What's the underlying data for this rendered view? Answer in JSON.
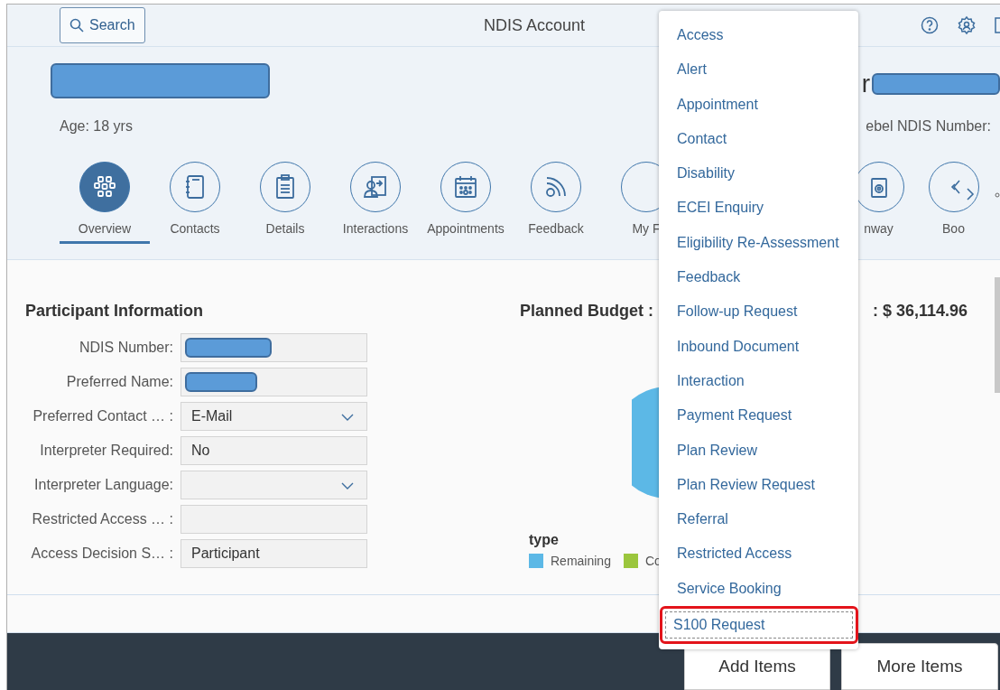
{
  "header": {
    "search_button": "Search",
    "title": "NDIS Account"
  },
  "profile": {
    "age": "Age: 18 yrs",
    "right_name_prefix": "r",
    "right_number_label": "ebel NDIS Number:"
  },
  "tabs": [
    {
      "label": "Overview",
      "selected": true
    },
    {
      "label": "Contacts",
      "selected": false
    },
    {
      "label": "Details",
      "selected": false
    },
    {
      "label": "Interactions",
      "selected": false
    },
    {
      "label": "Appointments",
      "selected": false
    },
    {
      "label": "Feedback",
      "selected": false
    },
    {
      "label": "My F",
      "selected": false
    },
    {
      "label": "nway",
      "selected": false
    },
    {
      "label": "Boo",
      "selected": false
    }
  ],
  "participant_information": {
    "title": "Participant Information",
    "fields": [
      {
        "label": "NDIS Number:",
        "kind": "redacted"
      },
      {
        "label": "Preferred Name:",
        "kind": "redacted"
      },
      {
        "label": "Preferred Contact … :",
        "kind": "select",
        "value": "E-Mail"
      },
      {
        "label": "Interpreter Required:",
        "kind": "text",
        "value": "No"
      },
      {
        "label": "Interpreter Language:",
        "kind": "select"
      },
      {
        "label": "Restricted Access … :",
        "kind": "text"
      },
      {
        "label": "Access Decision S… :",
        "kind": "text",
        "value": "Participant"
      }
    ]
  },
  "planned_budget": {
    "title": "Planned Budget :",
    "total": ": $ 36,114.96",
    "legend_title": "type",
    "legend": [
      {
        "label": "Remaining",
        "color": "#5cb8e6"
      },
      {
        "label": "Co",
        "color": "#9bc63d"
      }
    ]
  },
  "add_items_menu": {
    "items": [
      {
        "label": "Access",
        "selected": false
      },
      {
        "label": "Alert",
        "selected": false
      },
      {
        "label": "Appointment",
        "selected": false
      },
      {
        "label": "Contact",
        "selected": false
      },
      {
        "label": "Disability",
        "selected": false
      },
      {
        "label": "ECEI Enquiry",
        "selected": false
      },
      {
        "label": "Eligibility Re-Assessment",
        "selected": false
      },
      {
        "label": "Feedback",
        "selected": false
      },
      {
        "label": "Follow-up Request",
        "selected": false
      },
      {
        "label": "Inbound Document",
        "selected": false
      },
      {
        "label": "Interaction",
        "selected": false
      },
      {
        "label": "Payment Request",
        "selected": false
      },
      {
        "label": "Plan Review",
        "selected": false
      },
      {
        "label": "Plan Review Request",
        "selected": false
      },
      {
        "label": "Referral",
        "selected": false
      },
      {
        "label": "Restricted Access",
        "selected": false
      },
      {
        "label": "Service Booking",
        "selected": false
      },
      {
        "label": "S100 Request",
        "selected": true
      }
    ]
  },
  "footer": {
    "buttons": [
      "Add Items",
      "More Items"
    ]
  }
}
